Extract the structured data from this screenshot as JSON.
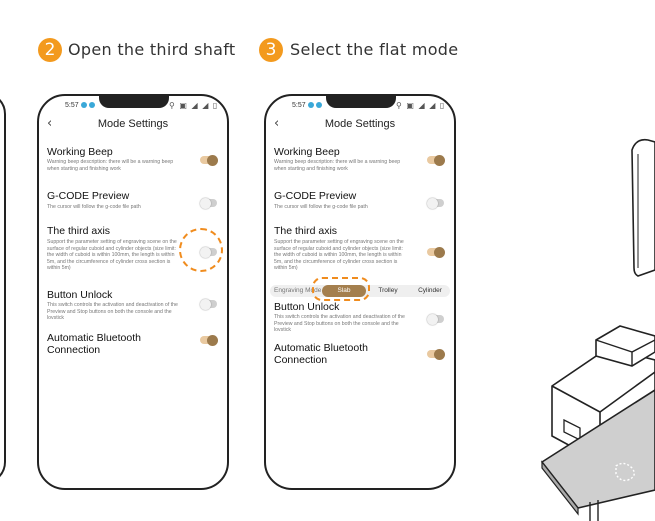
{
  "steps": [
    {
      "number": "2",
      "text": "Open the third shaft"
    },
    {
      "number": "3",
      "text": "Select the flat mode"
    }
  ],
  "phone": {
    "time": "5:57",
    "status_icons": "⚲ ▣ ◢ ◢ ▯",
    "back_icon": "back-chevron-icon",
    "title": "Mode Settings"
  },
  "settings": {
    "working_beep": {
      "title": "Working Beep",
      "desc": "Warning beep description: there will be a warning beep when starting and finishing work"
    },
    "gcode_preview": {
      "title": "G-CODE Preview",
      "desc": "The cursor will follow the g-code file path"
    },
    "third_axis": {
      "title": "The third axis",
      "desc": "Support the parameter setting of engraving scene on the surface of regular cuboid and cylinder objects (size limit: the width of cuboid is within 100mm, the length is within 5m, and the circumference of cylinder cross section is within 5m)"
    },
    "button_unlock": {
      "title": "Button Unlock",
      "desc": "This switch controls the activation and deactivation of the Preview and Stop buttons on both the console and the lovstick"
    },
    "auto_bluetooth": {
      "title_line1": "Automatic Bluetooth",
      "title_line2": "Connection"
    }
  },
  "engraving_mode": {
    "label": "Engraving Mode",
    "options": [
      "Slab",
      "Trolley",
      "Cylinder"
    ],
    "selected": "Slab"
  },
  "phone1_toggles": {
    "working_beep": "on",
    "gcode_preview": "off",
    "third_axis": "off",
    "button_unlock": "off",
    "auto_bluetooth": "on"
  },
  "phone2_toggles": {
    "working_beep": "on",
    "gcode_preview": "off",
    "third_axis": "on",
    "button_unlock": "off",
    "auto_bluetooth": "on"
  },
  "colors": {
    "accent_orange": "#f39a1e",
    "toggle_on": "#9c7a4c",
    "segment_selected": "#a47f4e"
  }
}
